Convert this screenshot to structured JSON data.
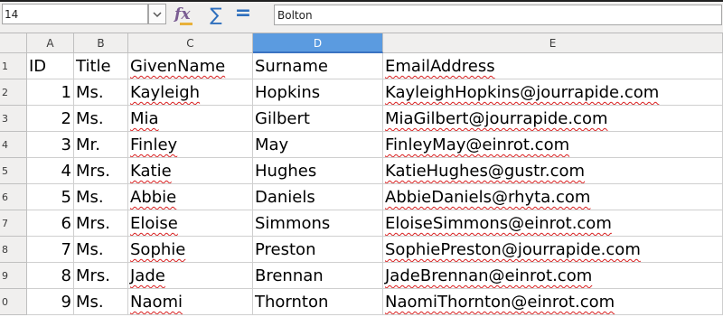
{
  "formula_bar": {
    "name_box": "14",
    "formula_value": "Bolton"
  },
  "icons": {
    "dropdown": "chevron-down-icon",
    "function_wizard": "fx-icon",
    "sum": "sum-icon",
    "equal": "equal-icon"
  },
  "colors": {
    "selected_column_header": "#5b9be0",
    "spellcheck_underline": "#d92020"
  },
  "columns": [
    "A",
    "B",
    "C",
    "D",
    "E"
  ],
  "selected_column": "D",
  "rows": [
    {
      "header": "1",
      "cells": [
        "ID",
        "Title",
        "GivenName",
        "Surname",
        "EmailAddress"
      ]
    },
    {
      "header": "2",
      "cells": [
        "1",
        "Ms.",
        "Kayleigh",
        "Hopkins",
        "KayleighHopkins@jourrapide.com"
      ]
    },
    {
      "header": "3",
      "cells": [
        "2",
        "Ms.",
        "Mia",
        "Gilbert",
        "MiaGilbert@jourrapide.com"
      ]
    },
    {
      "header": "4",
      "cells": [
        "3",
        "Mr.",
        "Finley",
        "May",
        "FinleyMay@einrot.com"
      ]
    },
    {
      "header": "5",
      "cells": [
        "4",
        "Mrs.",
        "Katie",
        "Hughes",
        "KatieHughes@gustr.com"
      ]
    },
    {
      "header": "6",
      "cells": [
        "5",
        "Ms.",
        "Abbie",
        "Daniels",
        "AbbieDaniels@rhyta.com"
      ]
    },
    {
      "header": "7",
      "cells": [
        "6",
        "Mrs.",
        "Eloise",
        "Simmons",
        "EloiseSimmons@einrot.com"
      ]
    },
    {
      "header": "8",
      "cells": [
        "7",
        "Ms.",
        "Sophie",
        "Preston",
        "SophiePreston@jourrapide.com"
      ]
    },
    {
      "header": "9",
      "cells": [
        "8",
        "Mrs.",
        "Jade",
        "Brennan",
        "JadeBrennan@einrot.com"
      ]
    },
    {
      "header": "0",
      "cells": [
        "9",
        "Ms.",
        "Naomi",
        "Thornton",
        "NaomiThornton@einrot.com"
      ]
    }
  ]
}
